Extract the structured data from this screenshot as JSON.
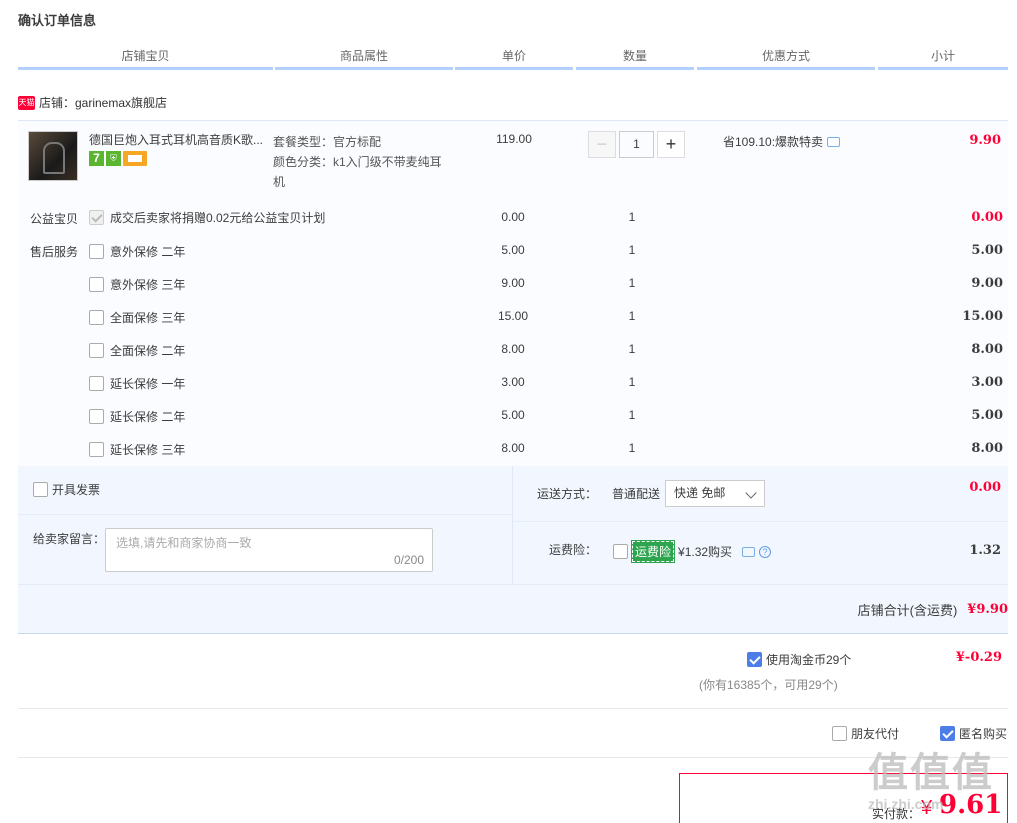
{
  "page_title": "确认订单信息",
  "headers": [
    "店铺宝贝",
    "商品属性",
    "单价",
    "数量",
    "优惠方式",
    "小计"
  ],
  "shop": {
    "badge": "天猫",
    "label": "店铺：garinemax旗舰店"
  },
  "item": {
    "name": "德国巨炮入耳式耳机高音质K歌...",
    "attrs": [
      "套餐类型：官方标配",
      "颜色分类：k1入门级不带麦纯耳",
      "机"
    ],
    "price": "119.00",
    "qty": "1",
    "qty_minus": "−",
    "qty_plus": "+",
    "promo": "省109.10:爆款特卖",
    "subtotal": "9.90"
  },
  "charity": {
    "label": "公益宝贝",
    "text": "成交后卖家将捐赠0.02元给公益宝贝计划",
    "price": "0.00",
    "qty": "1",
    "subtotal": "0.00"
  },
  "aftersale_label": "售后服务",
  "services": [
    {
      "name": "意外保修 二年",
      "price": "5.00",
      "qty": "1",
      "subtotal": "5.00"
    },
    {
      "name": "意外保修 三年",
      "price": "9.00",
      "qty": "1",
      "subtotal": "9.00"
    },
    {
      "name": "全面保修 三年",
      "price": "15.00",
      "qty": "1",
      "subtotal": "15.00"
    },
    {
      "name": "全面保修 二年",
      "price": "8.00",
      "qty": "1",
      "subtotal": "8.00"
    },
    {
      "name": "延长保修 一年",
      "price": "3.00",
      "qty": "1",
      "subtotal": "3.00"
    },
    {
      "name": "延长保修 二年",
      "price": "5.00",
      "qty": "1",
      "subtotal": "5.00"
    },
    {
      "name": "延长保修 三年",
      "price": "8.00",
      "qty": "1",
      "subtotal": "8.00"
    }
  ],
  "invoice": {
    "label": "开具发票"
  },
  "shipping": {
    "label": "运送方式：",
    "type": "普通配送",
    "selected": "快递 免邮",
    "fee": "0.00"
  },
  "message": {
    "label": "给卖家留言：",
    "placeholder": "选填,请先和商家协商一致",
    "count": "0/200"
  },
  "insurance": {
    "label": "运费险：",
    "badge": "运费险",
    "text": "¥1.32购买",
    "amount": "1.32"
  },
  "shop_total": {
    "label": "店铺合计(含运费)",
    "value": "¥9.90"
  },
  "coins": {
    "label": "使用淘金币29个",
    "note": "(你有16385个，可用29个)",
    "value": "¥-0.29"
  },
  "options": {
    "friend_pay": "朋友代付",
    "anonymous": "匿名购买"
  },
  "final": {
    "label": "实付款：",
    "currency": "¥",
    "value": "9.61"
  },
  "watermark": {
    "main": "值值值",
    "sub": "zhi.zhi.com"
  },
  "colors": {
    "accent_red": "#ff0036",
    "header_line": "#b2d1ff",
    "checkbox_blue": "#4d7ee8"
  }
}
